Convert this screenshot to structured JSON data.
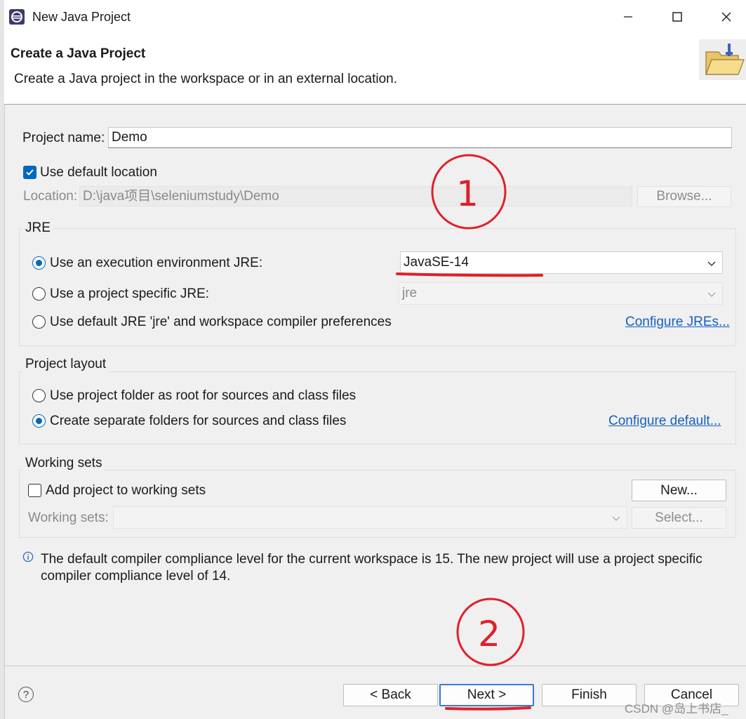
{
  "window": {
    "title": "New Java Project",
    "minimize_label": "—",
    "maximize_label": "☐",
    "close_label": "✕"
  },
  "header": {
    "title": "Create a Java Project",
    "description": "Create a Java project in the workspace or in an external location."
  },
  "project": {
    "name_label": "Project name:",
    "name_value": "Demo",
    "use_default_location_label": "Use default location",
    "use_default_location_checked": true,
    "location_label": "Location:",
    "location_value": "D:\\java项目\\seleniumstudy\\Demo",
    "browse_label": "Browse..."
  },
  "jre": {
    "group_label": "JRE",
    "exec_env_label": "Use an execution environment JRE:",
    "exec_env_value": "JavaSE-14",
    "project_specific_label": "Use a project specific JRE:",
    "project_specific_value": "jre",
    "default_jre_label": "Use default JRE 'jre' and workspace compiler preferences",
    "configure_link": "Configure JREs...",
    "selected": "exec_env"
  },
  "layout": {
    "group_label": "Project layout",
    "option_root_label": "Use project folder as root for sources and class files",
    "option_separate_label": "Create separate folders for sources and class files",
    "configure_link": "Configure default...",
    "selected": "separate"
  },
  "working_sets": {
    "group_label": "Working sets",
    "add_label": "Add project to working sets",
    "add_checked": false,
    "new_button": "New...",
    "sets_label": "Working sets:",
    "sets_value": "",
    "select_button": "Select..."
  },
  "info": {
    "icon": "info-icon",
    "line1": "The default compiler compliance level for the current workspace is 15. The new project will use a project specific",
    "line2": "compiler compliance level of 14."
  },
  "footer": {
    "help_label": "?",
    "back_button": "< Back",
    "next_button": "Next >",
    "finish_button": "Finish",
    "cancel_button": "Cancel"
  },
  "annotations": {
    "circle_1_label": "1",
    "circle_2_label": "2",
    "color": "#e0202a"
  },
  "watermark": "CSDN @岛上书店_",
  "colors": {
    "accent": "#0067c0",
    "link": "#1560c4",
    "annotation": "#e0202a"
  }
}
